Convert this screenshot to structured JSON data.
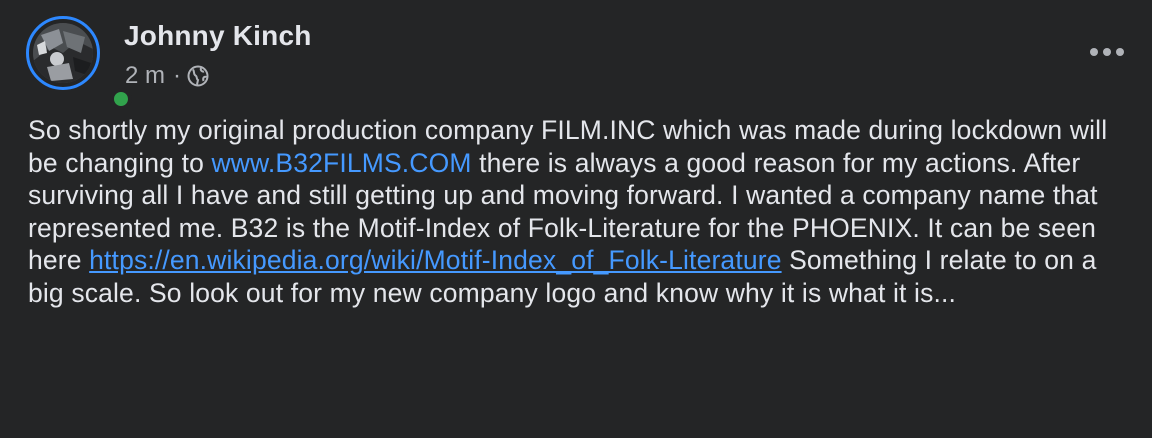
{
  "colors": {
    "background": "#242526",
    "primary_text": "#e4e6eb",
    "secondary_text": "#b0b3b8",
    "link": "#4599ff",
    "online": "#31a24c",
    "avatar_ring": "#2d88ff"
  },
  "post": {
    "author": "Johnny Kinch",
    "timestamp": "2 m",
    "separator": "·",
    "audience_icon": "globe-icon",
    "more_icon": "more-options-icon",
    "body": {
      "text_1": "So shortly my original production company FILM.INC which was made during lockdown will be changing to ",
      "link_1": "www.B32FILMS.COM",
      "text_2": " there is always a good reason for my actions. After surviving all I have and still getting up and moving forward. I wanted a company name that represented me. B32 is the Motif-Index of Folk-Literature for the PHOENIX. It can be seen here ",
      "link_2": "https://en.wikipedia.org/wiki/Motif-Index_of_Folk-Literature",
      "text_3": " Something I relate to on a big scale. So look out for my new company logo and know why it is what it is..."
    }
  }
}
